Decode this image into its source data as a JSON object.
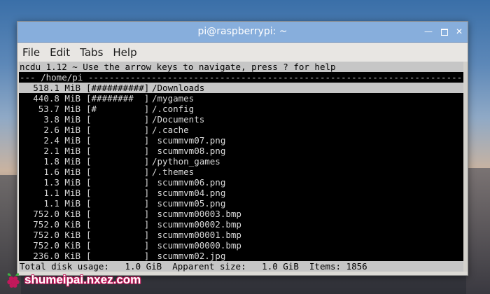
{
  "window": {
    "title": "pi@raspberrypi: ~"
  },
  "menu": [
    "File",
    "Edit",
    "Tabs",
    "Help"
  ],
  "ncdu": {
    "header": "ncdu 1.12 ~ Use the arrow keys to navigate, press ? for help",
    "path_line": "--- /home/pi ----------------------------------------------------------------------------",
    "rows": [
      {
        "size": "518.1 MiB",
        "bar": "[##########]",
        "name": "/Downloads",
        "selected": true
      },
      {
        "size": "440.8 MiB",
        "bar": "[########  ]",
        "name": "/mygames"
      },
      {
        "size": "53.7 MiB",
        "bar": "[#         ]",
        "name": "/.config"
      },
      {
        "size": "3.8 MiB",
        "bar": "[          ]",
        "name": "/Documents"
      },
      {
        "size": "2.6 MiB",
        "bar": "[          ]",
        "name": "/.cache"
      },
      {
        "size": "2.4 MiB",
        "bar": "[          ]",
        "name": " scummvm07.png"
      },
      {
        "size": "2.1 MiB",
        "bar": "[          ]",
        "name": " scummvm08.png"
      },
      {
        "size": "1.8 MiB",
        "bar": "[          ]",
        "name": "/python_games"
      },
      {
        "size": "1.6 MiB",
        "bar": "[          ]",
        "name": "/.themes"
      },
      {
        "size": "1.3 MiB",
        "bar": "[          ]",
        "name": " scummvm06.png"
      },
      {
        "size": "1.1 MiB",
        "bar": "[          ]",
        "name": " scummvm04.png"
      },
      {
        "size": "1.1 MiB",
        "bar": "[          ]",
        "name": " scummvm05.png"
      },
      {
        "size": "752.0 KiB",
        "bar": "[          ]",
        "name": " scummvm00003.bmp"
      },
      {
        "size": "752.0 KiB",
        "bar": "[          ]",
        "name": " scummvm00002.bmp"
      },
      {
        "size": "752.0 KiB",
        "bar": "[          ]",
        "name": " scummvm00001.bmp"
      },
      {
        "size": "752.0 KiB",
        "bar": "[          ]",
        "name": " scummvm00000.bmp"
      },
      {
        "size": "236.0 KiB",
        "bar": "[          ]",
        "name": " scummvm02.jpg"
      }
    ],
    "footer": "Total disk usage:   1.0 GiB  Apparent size:   1.0 GiB  Items: 1856"
  },
  "watermark": {
    "text": "shumeipai.nxez.com"
  },
  "colors": {
    "titlebar": "#87aedc",
    "terminal_bg": "#000000",
    "highlight": "#c6c6c6",
    "watermark_outline": "#c2185b"
  },
  "icons": {
    "minimize": "minimize-icon",
    "maximize": "maximize-icon",
    "close": "close-icon",
    "logo": "raspberry-logo"
  }
}
